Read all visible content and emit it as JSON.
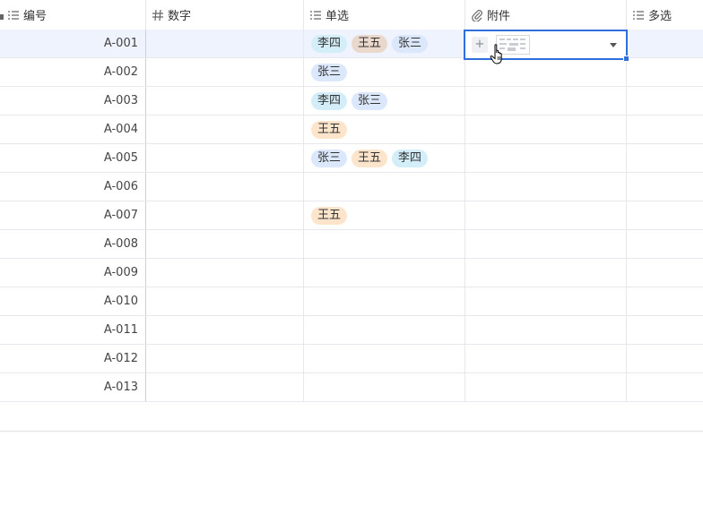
{
  "columns": [
    {
      "key": "id",
      "label": "编号",
      "icon": "list-icon"
    },
    {
      "key": "num",
      "label": "数字",
      "icon": "hash-icon"
    },
    {
      "key": "single",
      "label": "单选",
      "icon": "list-icon"
    },
    {
      "key": "attach",
      "label": "附件",
      "icon": "paperclip-icon"
    },
    {
      "key": "multi",
      "label": "多选",
      "icon": "list-icon"
    }
  ],
  "rows": [
    {
      "id": "A-001",
      "single": [
        {
          "text": "李四",
          "color": "cyan"
        },
        {
          "text": "王五",
          "color": "tan"
        },
        {
          "text": "张三",
          "color": "blue"
        }
      ]
    },
    {
      "id": "A-002",
      "single": [
        {
          "text": "张三",
          "color": "blue"
        }
      ]
    },
    {
      "id": "A-003",
      "single": [
        {
          "text": "李四",
          "color": "cyan"
        },
        {
          "text": "张三",
          "color": "blue"
        }
      ]
    },
    {
      "id": "A-004",
      "single": [
        {
          "text": "王五",
          "color": "peach"
        }
      ]
    },
    {
      "id": "A-005",
      "single": [
        {
          "text": "张三",
          "color": "blue"
        },
        {
          "text": "王五",
          "color": "peach"
        },
        {
          "text": "李四",
          "color": "cyan"
        }
      ]
    },
    {
      "id": "A-006",
      "single": []
    },
    {
      "id": "A-007",
      "single": [
        {
          "text": "王五",
          "color": "peach"
        }
      ]
    },
    {
      "id": "A-008",
      "single": []
    },
    {
      "id": "A-009",
      "single": []
    },
    {
      "id": "A-010",
      "single": []
    },
    {
      "id": "A-011",
      "single": []
    },
    {
      "id": "A-012",
      "single": []
    },
    {
      "id": "A-013",
      "single": []
    }
  ],
  "editor": {
    "add_symbol": "+",
    "accent": "#2f6fdb"
  },
  "colors": {
    "blue": "#dbe8fb",
    "cyan": "#d3eef8",
    "peach": "#fde5cc",
    "tan": "#ebd8cd"
  }
}
